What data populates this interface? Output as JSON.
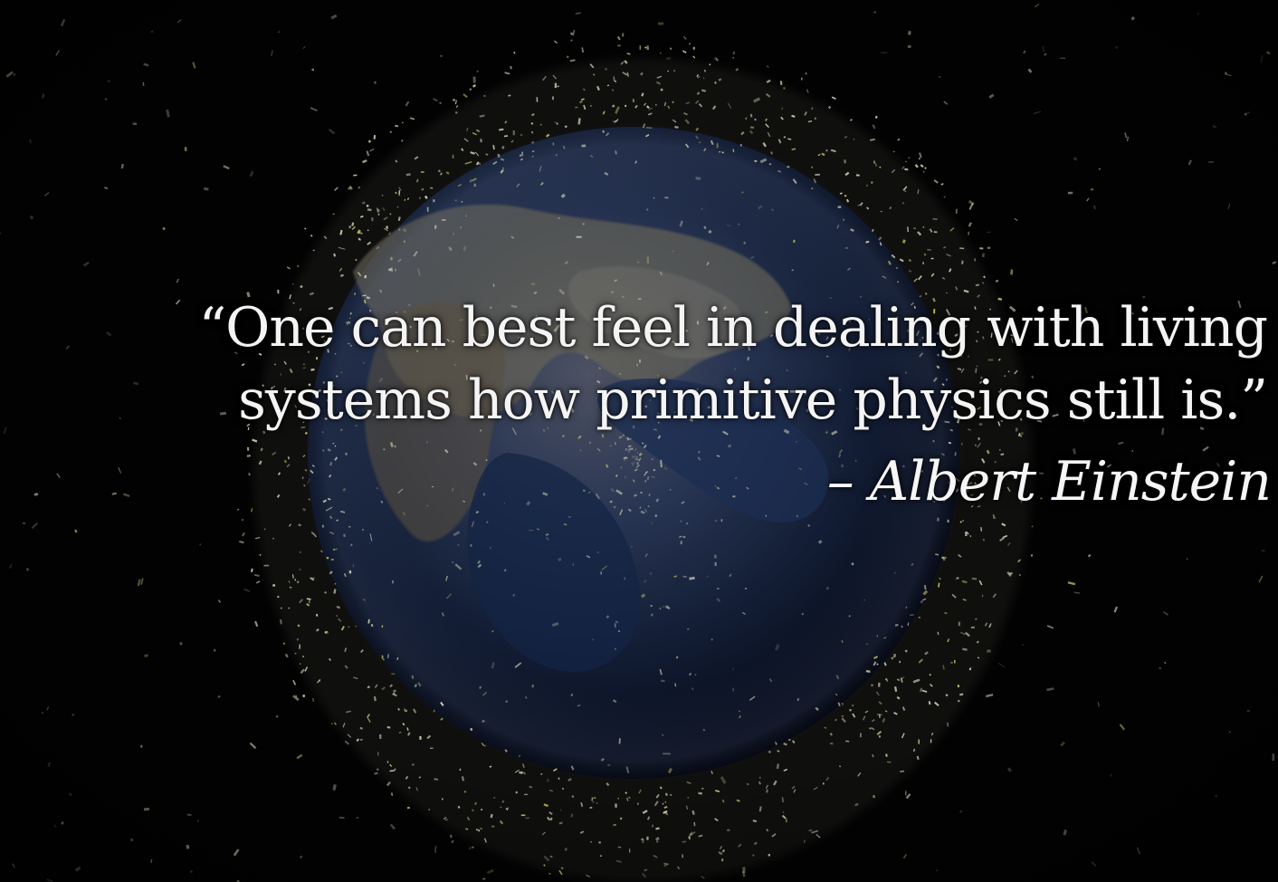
{
  "quote": {
    "line_1": "“One can best feel in dealing with living",
    "line_2": "systems how primitive physics still is.”",
    "attribution": "– Albert Einstein"
  },
  "image": {
    "subject": "earth-debris-field",
    "colors": {
      "background": "#020203",
      "ocean": "#142443",
      "land": "#6d6655",
      "debris": "#d9d7b8",
      "text": "#f4f4f4"
    }
  }
}
